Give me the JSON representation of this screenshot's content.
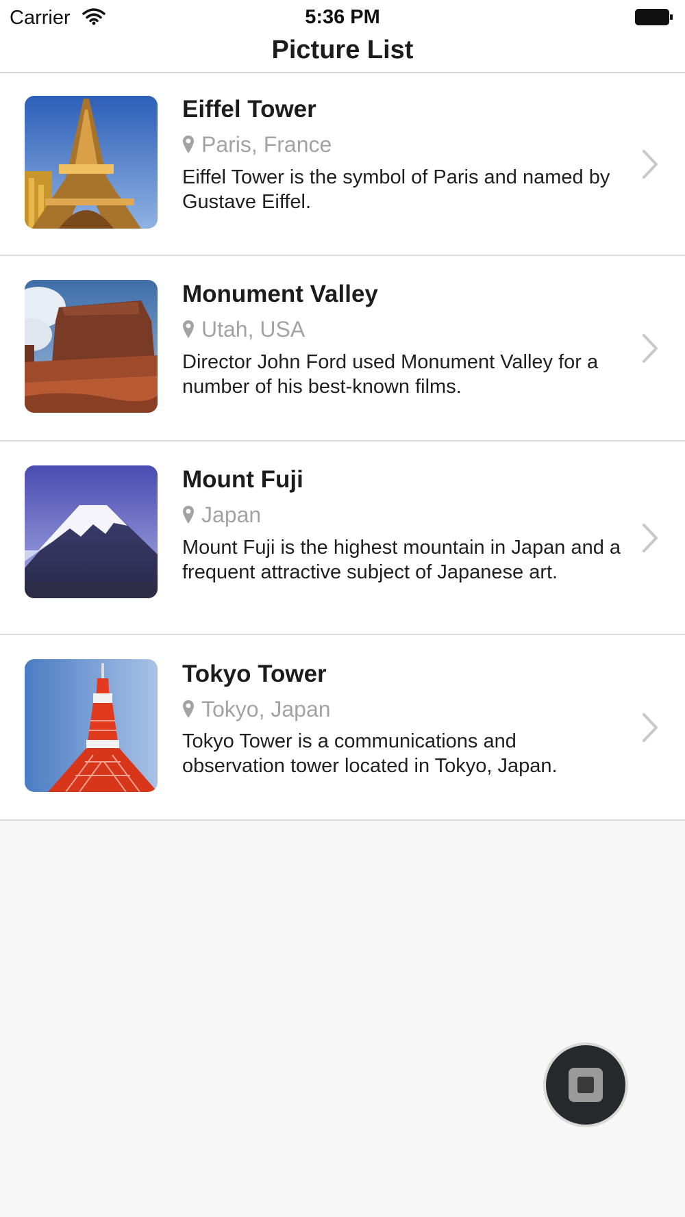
{
  "status_bar": {
    "carrier": "Carrier",
    "time": "5:36 PM",
    "wifi_icon": "wifi-icon",
    "battery_icon": "battery-full-icon"
  },
  "nav": {
    "title": "Picture List"
  },
  "items": [
    {
      "title": "Eiffel Tower",
      "location": "Paris, France",
      "description": "Eiffel Tower is the symbol of Paris and named by Gustave Eiffel.",
      "thumbnail": "eiffel-tower-photo"
    },
    {
      "title": "Monument Valley",
      "location": "Utah, USA",
      "description": "Director John Ford used Monument Valley for a number of his best-known films.",
      "thumbnail": "monument-valley-photo"
    },
    {
      "title": "Mount Fuji",
      "location": "Japan",
      "description": "Mount Fuji is the highest mountain in Japan and a frequent attractive subject of Japanese art.",
      "thumbnail": "mount-fuji-photo"
    },
    {
      "title": "Tokyo Tower",
      "location": "Tokyo, Japan",
      "description": "Tokyo Tower is a communications and observation tower located in Tokyo, Japan.",
      "thumbnail": "tokyo-tower-photo"
    }
  ],
  "assistive_touch": {
    "icon": "assistive-touch-icon"
  },
  "colors": {
    "background": "#f7f7f7",
    "row_background": "#ffffff",
    "separator": "#dcdcdc",
    "secondary_text": "#a3a3a3",
    "chevron": "#c7c7cc"
  }
}
